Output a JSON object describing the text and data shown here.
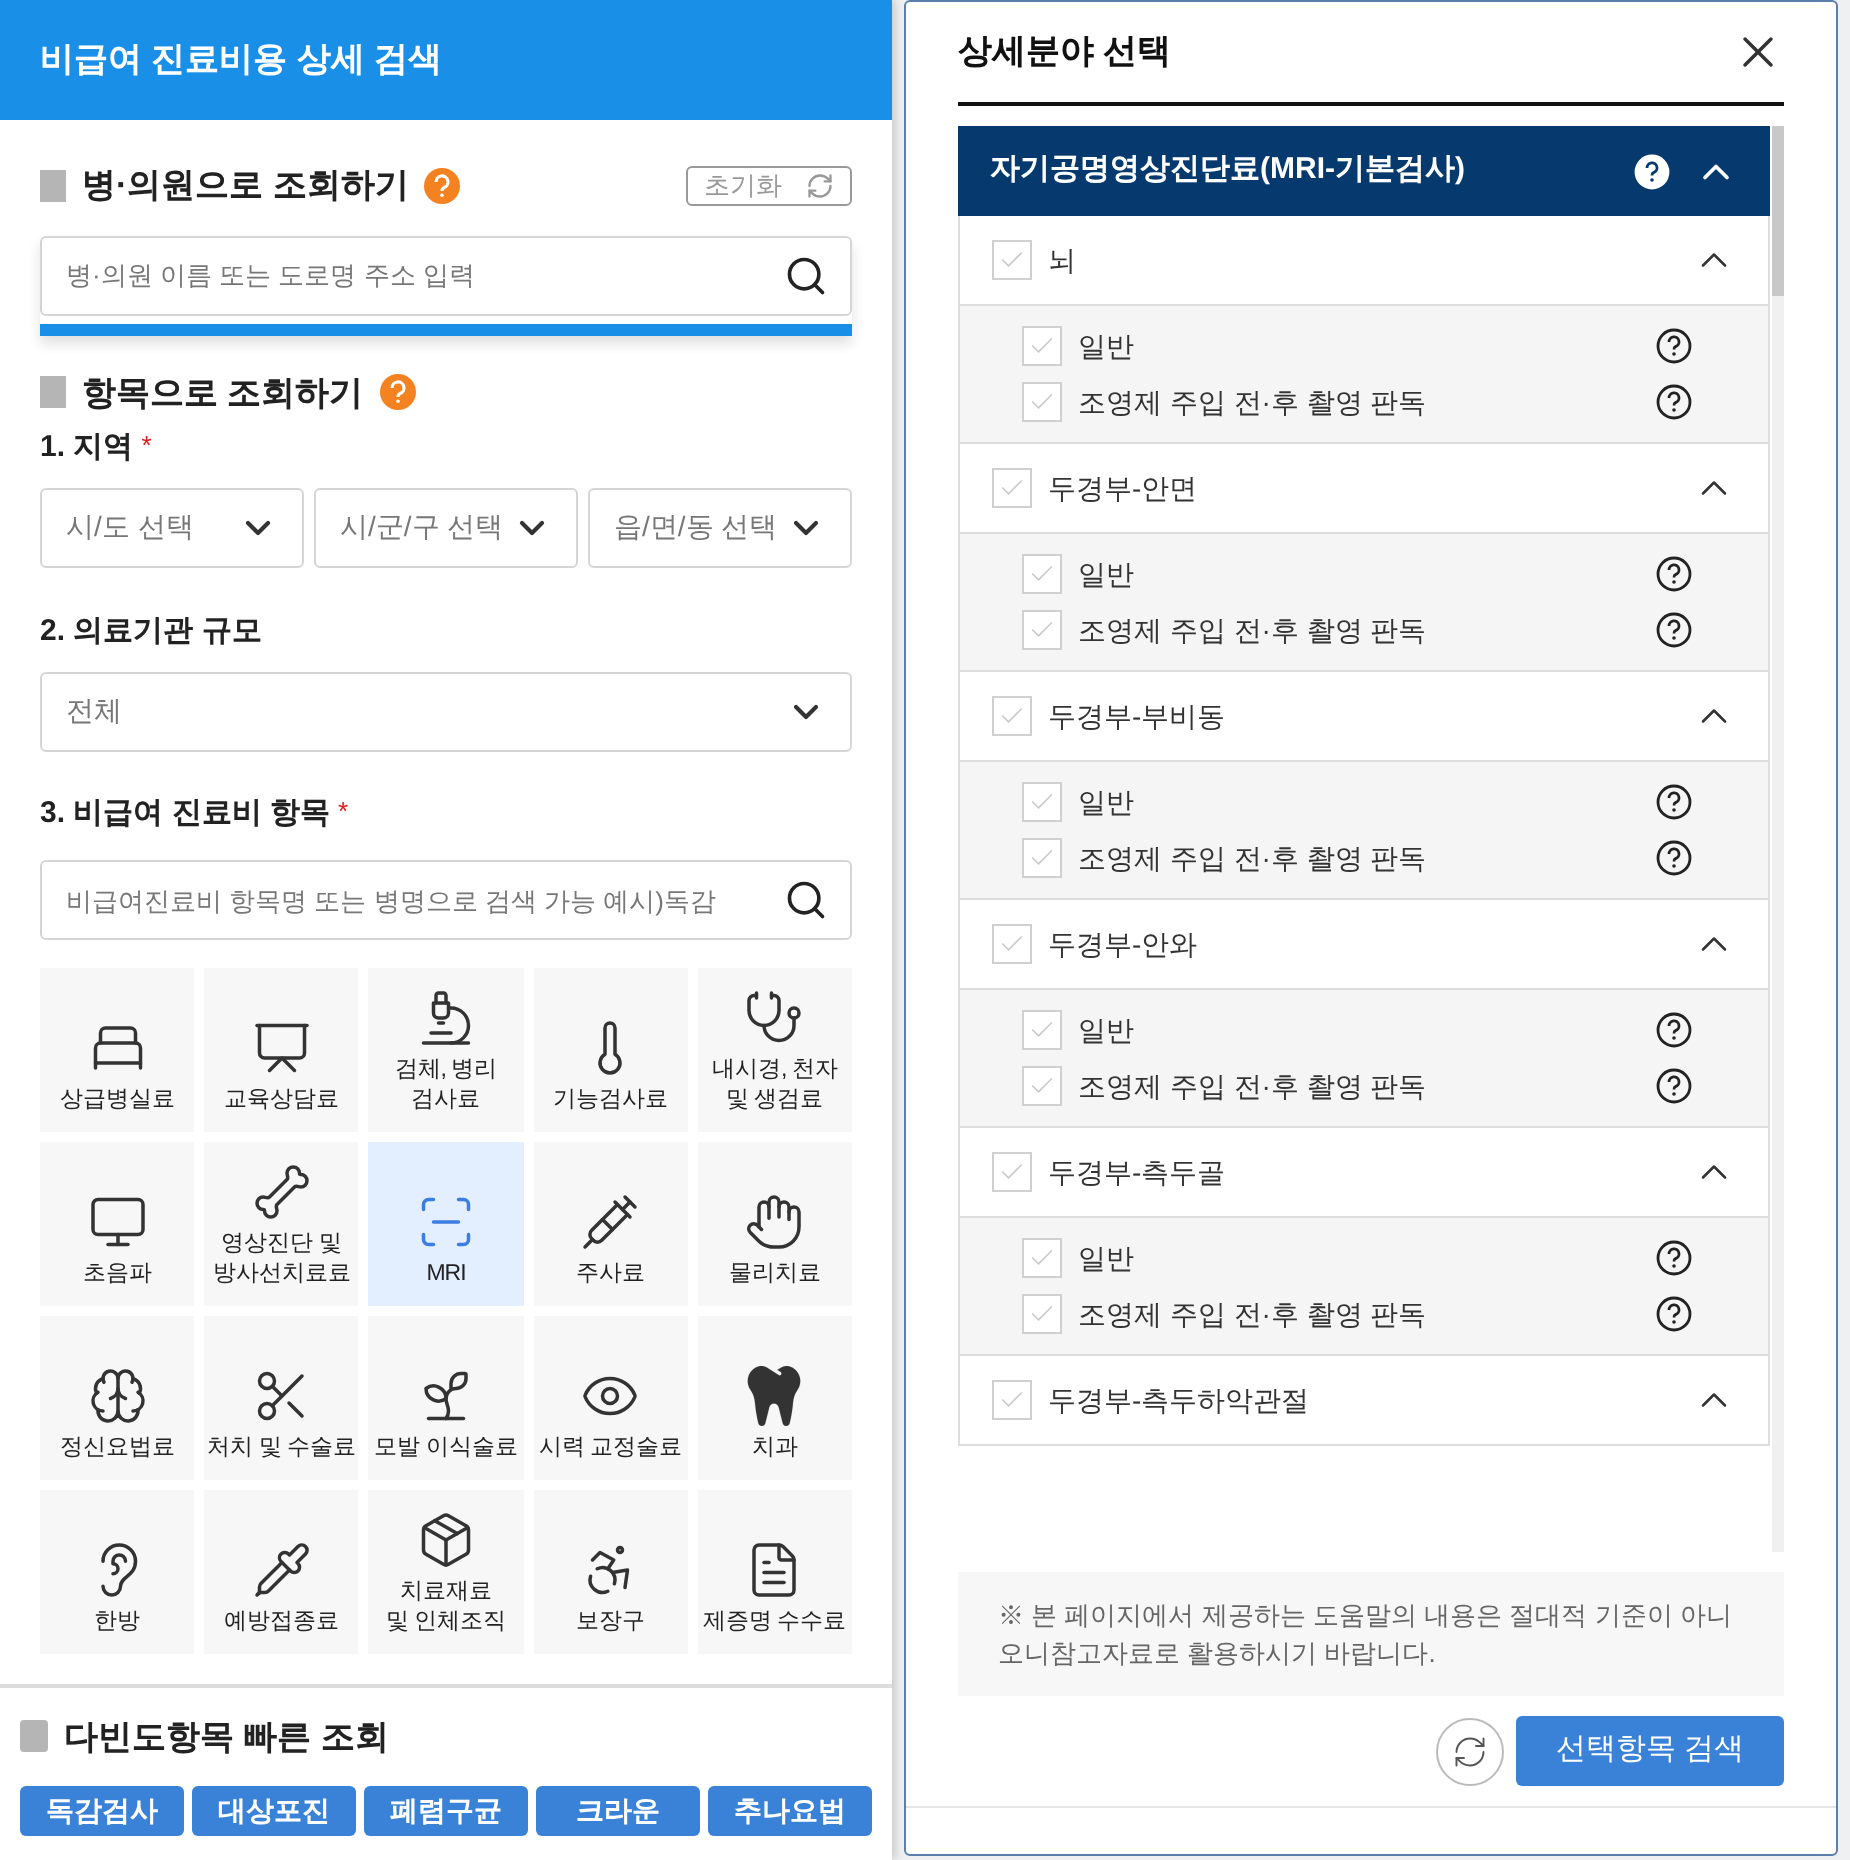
{
  "header": {
    "title": "비급여 진료비용 상세 검색"
  },
  "hospital_search": {
    "title": "병·의원으로 조회하기",
    "reset_label": "초기화",
    "placeholder": "병·의원 이름 또는 도로명 주소 입력"
  },
  "item_search": {
    "title": "항목으로 조회하기",
    "region": {
      "label": "1. 지역",
      "required_mark": "*",
      "selects": [
        {
          "placeholder": "시/도 선택"
        },
        {
          "placeholder": "시/군/구 선택"
        },
        {
          "placeholder": "읍/면/동 선택"
        }
      ]
    },
    "scale": {
      "label": "2. 의료기관 규모",
      "value": "전체"
    },
    "items": {
      "label": "3. 비급여 진료비 항목",
      "required_mark": "*",
      "placeholder": "비급여진료비 항목명 또는 병명으로 검색 가능 예시)독감"
    },
    "categories": [
      {
        "lines": [
          "상급병실료"
        ],
        "selected": false
      },
      {
        "lines": [
          "교육상담료"
        ],
        "selected": false
      },
      {
        "lines": [
          "검체, 병리",
          "검사료"
        ],
        "selected": false
      },
      {
        "lines": [
          "기능검사료"
        ],
        "selected": false
      },
      {
        "lines": [
          "내시경, 천자",
          "및 생검료"
        ],
        "selected": false
      },
      {
        "lines": [
          "초음파"
        ],
        "selected": false
      },
      {
        "lines": [
          "영상진단 및",
          "방사선치료료"
        ],
        "selected": false
      },
      {
        "lines": [
          "MRI"
        ],
        "selected": true
      },
      {
        "lines": [
          "주사료"
        ],
        "selected": false
      },
      {
        "lines": [
          "물리치료"
        ],
        "selected": false
      },
      {
        "lines": [
          "정신요법료"
        ],
        "selected": false
      },
      {
        "lines": [
          "처치 및 수술료"
        ],
        "selected": false
      },
      {
        "lines": [
          "모발 이식술료"
        ],
        "selected": false
      },
      {
        "lines": [
          "시력 교정술료"
        ],
        "selected": false
      },
      {
        "lines": [
          "치과"
        ],
        "selected": false
      },
      {
        "lines": [
          "한방"
        ],
        "selected": false
      },
      {
        "lines": [
          "예방접종료"
        ],
        "selected": false
      },
      {
        "lines": [
          "치료재료",
          "및 인체조직"
        ],
        "selected": false
      },
      {
        "lines": [
          "보장구"
        ],
        "selected": false
      },
      {
        "lines": [
          "제증명 수수료"
        ],
        "selected": false
      }
    ]
  },
  "quick_search": {
    "title": "다빈도항목 빠른 조회",
    "buttons": [
      "독감검사",
      "대상포진",
      "폐렴구균",
      "크라운",
      "추나요법"
    ]
  },
  "modal": {
    "title": "상세분야 선택",
    "section": {
      "title": "자기공명영상진단료(MRI-기본검사)",
      "expanded": true,
      "groups": [
        {
          "label": "뇌",
          "checked": false,
          "expanded": true,
          "children": [
            {
              "label": "일반",
              "checked": false
            },
            {
              "label": "조영제 주입 전·후 촬영 판독",
              "checked": false
            }
          ]
        },
        {
          "label": "두경부-안면",
          "checked": false,
          "expanded": true,
          "children": [
            {
              "label": "일반",
              "checked": false
            },
            {
              "label": "조영제 주입 전·후 촬영 판독",
              "checked": false
            }
          ]
        },
        {
          "label": "두경부-부비동",
          "checked": false,
          "expanded": true,
          "children": [
            {
              "label": "일반",
              "checked": false
            },
            {
              "label": "조영제 주입 전·후 촬영 판독",
              "checked": false
            }
          ]
        },
        {
          "label": "두경부-안와",
          "checked": false,
          "expanded": true,
          "children": [
            {
              "label": "일반",
              "checked": false
            },
            {
              "label": "조영제 주입 전·후 촬영 판독",
              "checked": false
            }
          ]
        },
        {
          "label": "두경부-측두골",
          "checked": false,
          "expanded": true,
          "children": [
            {
              "label": "일반",
              "checked": false
            },
            {
              "label": "조영제 주입 전·후 촬영 판독",
              "checked": false
            }
          ]
        },
        {
          "label": "두경부-측두하악관절",
          "checked": false,
          "expanded": true
        }
      ]
    },
    "notice": "※ 본 페이지에서 제공하는 도움말의 내용은 절대적 기준이 아니오니참고자료로 활용하시기 바랍니다.",
    "search_button": "선택항목 검색"
  }
}
